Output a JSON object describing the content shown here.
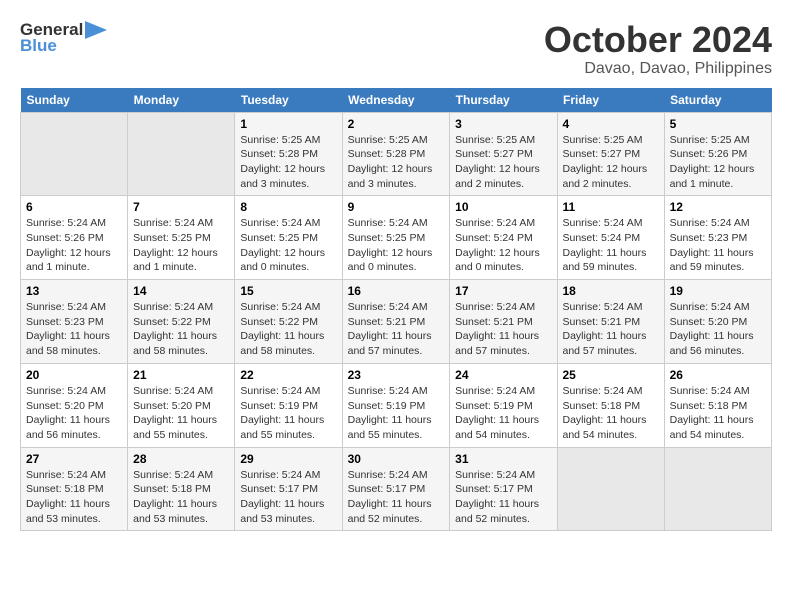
{
  "logo": {
    "line1": "General",
    "line2": "Blue"
  },
  "title": "October 2024",
  "location": "Davao, Davao, Philippines",
  "weekdays": [
    "Sunday",
    "Monday",
    "Tuesday",
    "Wednesday",
    "Thursday",
    "Friday",
    "Saturday"
  ],
  "weeks": [
    [
      {
        "day": "",
        "info": ""
      },
      {
        "day": "",
        "info": ""
      },
      {
        "day": "1",
        "info": "Sunrise: 5:25 AM\nSunset: 5:28 PM\nDaylight: 12 hours and 3 minutes."
      },
      {
        "day": "2",
        "info": "Sunrise: 5:25 AM\nSunset: 5:28 PM\nDaylight: 12 hours and 3 minutes."
      },
      {
        "day": "3",
        "info": "Sunrise: 5:25 AM\nSunset: 5:27 PM\nDaylight: 12 hours and 2 minutes."
      },
      {
        "day": "4",
        "info": "Sunrise: 5:25 AM\nSunset: 5:27 PM\nDaylight: 12 hours and 2 minutes."
      },
      {
        "day": "5",
        "info": "Sunrise: 5:25 AM\nSunset: 5:26 PM\nDaylight: 12 hours and 1 minute."
      }
    ],
    [
      {
        "day": "6",
        "info": "Sunrise: 5:24 AM\nSunset: 5:26 PM\nDaylight: 12 hours and 1 minute."
      },
      {
        "day": "7",
        "info": "Sunrise: 5:24 AM\nSunset: 5:25 PM\nDaylight: 12 hours and 1 minute."
      },
      {
        "day": "8",
        "info": "Sunrise: 5:24 AM\nSunset: 5:25 PM\nDaylight: 12 hours and 0 minutes."
      },
      {
        "day": "9",
        "info": "Sunrise: 5:24 AM\nSunset: 5:25 PM\nDaylight: 12 hours and 0 minutes."
      },
      {
        "day": "10",
        "info": "Sunrise: 5:24 AM\nSunset: 5:24 PM\nDaylight: 12 hours and 0 minutes."
      },
      {
        "day": "11",
        "info": "Sunrise: 5:24 AM\nSunset: 5:24 PM\nDaylight: 11 hours and 59 minutes."
      },
      {
        "day": "12",
        "info": "Sunrise: 5:24 AM\nSunset: 5:23 PM\nDaylight: 11 hours and 59 minutes."
      }
    ],
    [
      {
        "day": "13",
        "info": "Sunrise: 5:24 AM\nSunset: 5:23 PM\nDaylight: 11 hours and 58 minutes."
      },
      {
        "day": "14",
        "info": "Sunrise: 5:24 AM\nSunset: 5:22 PM\nDaylight: 11 hours and 58 minutes."
      },
      {
        "day": "15",
        "info": "Sunrise: 5:24 AM\nSunset: 5:22 PM\nDaylight: 11 hours and 58 minutes."
      },
      {
        "day": "16",
        "info": "Sunrise: 5:24 AM\nSunset: 5:21 PM\nDaylight: 11 hours and 57 minutes."
      },
      {
        "day": "17",
        "info": "Sunrise: 5:24 AM\nSunset: 5:21 PM\nDaylight: 11 hours and 57 minutes."
      },
      {
        "day": "18",
        "info": "Sunrise: 5:24 AM\nSunset: 5:21 PM\nDaylight: 11 hours and 57 minutes."
      },
      {
        "day": "19",
        "info": "Sunrise: 5:24 AM\nSunset: 5:20 PM\nDaylight: 11 hours and 56 minutes."
      }
    ],
    [
      {
        "day": "20",
        "info": "Sunrise: 5:24 AM\nSunset: 5:20 PM\nDaylight: 11 hours and 56 minutes."
      },
      {
        "day": "21",
        "info": "Sunrise: 5:24 AM\nSunset: 5:20 PM\nDaylight: 11 hours and 55 minutes."
      },
      {
        "day": "22",
        "info": "Sunrise: 5:24 AM\nSunset: 5:19 PM\nDaylight: 11 hours and 55 minutes."
      },
      {
        "day": "23",
        "info": "Sunrise: 5:24 AM\nSunset: 5:19 PM\nDaylight: 11 hours and 55 minutes."
      },
      {
        "day": "24",
        "info": "Sunrise: 5:24 AM\nSunset: 5:19 PM\nDaylight: 11 hours and 54 minutes."
      },
      {
        "day": "25",
        "info": "Sunrise: 5:24 AM\nSunset: 5:18 PM\nDaylight: 11 hours and 54 minutes."
      },
      {
        "day": "26",
        "info": "Sunrise: 5:24 AM\nSunset: 5:18 PM\nDaylight: 11 hours and 54 minutes."
      }
    ],
    [
      {
        "day": "27",
        "info": "Sunrise: 5:24 AM\nSunset: 5:18 PM\nDaylight: 11 hours and 53 minutes."
      },
      {
        "day": "28",
        "info": "Sunrise: 5:24 AM\nSunset: 5:18 PM\nDaylight: 11 hours and 53 minutes."
      },
      {
        "day": "29",
        "info": "Sunrise: 5:24 AM\nSunset: 5:17 PM\nDaylight: 11 hours and 53 minutes."
      },
      {
        "day": "30",
        "info": "Sunrise: 5:24 AM\nSunset: 5:17 PM\nDaylight: 11 hours and 52 minutes."
      },
      {
        "day": "31",
        "info": "Sunrise: 5:24 AM\nSunset: 5:17 PM\nDaylight: 11 hours and 52 minutes."
      },
      {
        "day": "",
        "info": ""
      },
      {
        "day": "",
        "info": ""
      }
    ]
  ]
}
